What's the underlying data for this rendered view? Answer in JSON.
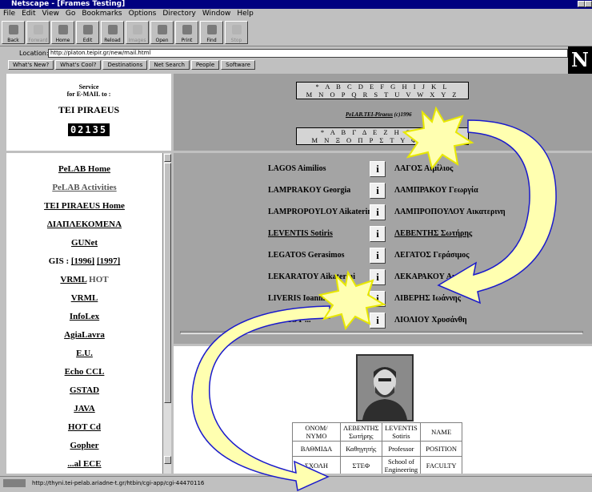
{
  "window": {
    "title": "Netscape - [Frames Testing]"
  },
  "menu": [
    "File",
    "Edit",
    "View",
    "Go",
    "Bookmarks",
    "Options",
    "Directory",
    "Window",
    "Help"
  ],
  "toolbar": [
    {
      "label": "Back",
      "icon": "back-arrow-icon",
      "enabled": true
    },
    {
      "label": "Forward",
      "icon": "forward-arrow-icon",
      "enabled": false
    },
    {
      "label": "Home",
      "icon": "home-icon",
      "enabled": true
    },
    {
      "label": "Edit",
      "icon": "edit-icon",
      "enabled": true
    },
    {
      "label": "Reload",
      "icon": "reload-icon",
      "enabled": true
    },
    {
      "label": "Images",
      "icon": "images-icon",
      "enabled": false
    },
    {
      "label": "Open",
      "icon": "open-icon",
      "enabled": true
    },
    {
      "label": "Print",
      "icon": "print-icon",
      "enabled": true
    },
    {
      "label": "Find",
      "icon": "find-icon",
      "enabled": true
    },
    {
      "label": "Stop",
      "icon": "stop-icon",
      "enabled": false
    }
  ],
  "location": {
    "label": "Location:",
    "url": "http://platon.teipir.gr/new/mail.html"
  },
  "directory_buttons": [
    "What's New?",
    "What's Cool?",
    "Destinations",
    "Net Search",
    "People",
    "Software"
  ],
  "brand_logo": "N",
  "service": {
    "line1": "Service",
    "line2": "for E-MAIL to :",
    "org": "TEI PIRAEUS",
    "counter": "02135"
  },
  "letters": {
    "latin_row1": "* A B C D E F G H I J K L",
    "latin_row2": "M N O P Q R S T U V W X Y Z",
    "credit": "PeLAB.TEI-Piraeus",
    "credit_year": "(c)1996",
    "greek_row1": "* Α Β Γ Δ Ε Ζ Η Θ Ι Κ Λ",
    "greek_row2": "Μ Ν Ξ Ο Π Ρ Σ Τ Υ Φ Χ Ψ Ω"
  },
  "nav": {
    "pelab_home": "PeLAB Home",
    "pelab_activities": "PeLAB Activities",
    "tei_home": "TEI PIRAEUS Home",
    "diapl": "ΔΙΑΠΛΕΚΟΜΕΝΑ",
    "gunet": "GUNet",
    "gis_prefix": "GIS :",
    "gis_1996": "[1996]",
    "gis_1997": "[1997]",
    "vrml_hot_a": "VRML",
    "vrml_hot_b": "HOT",
    "vrml": "VRML",
    "infolex": "InfoLex",
    "agialavra": "AgiaLavra",
    "eu": "E.U.",
    "echo": "Echo CCL",
    "gstad": "GSTAD",
    "java": "JAVA",
    "hotcd": "HOT Cd",
    "gopher": "Gopher",
    "last": "...al ECE"
  },
  "people": [
    {
      "latin": "LAGOS Aimilios",
      "greek": "ΛΑΓΟΣ Αιμίλιος",
      "link": false
    },
    {
      "latin": "LAMPRAKOY Georgia",
      "greek": "ΛΑΜΠΡΑΚΟΥ Γεωργία",
      "link": false
    },
    {
      "latin": "LAMPROPOYLOY Aikaterini",
      "greek": "ΛΑΜΠΡΟΠΟΥΛΟΥ Αικατερινη",
      "link": false
    },
    {
      "latin": "LEVENTIS Sotiris",
      "greek": "ΛΕΒΕΝΤΗΣ Σωτήρης",
      "link": true
    },
    {
      "latin": "LEGATOS Gerasimos",
      "greek": "ΛΕΓΑΤΟΣ Γεράσιμος",
      "link": false
    },
    {
      "latin": "LEKARATOY Aikaterini",
      "greek": "ΛΕΚΑΡΑΚΟΥ Αικατερινη",
      "link": false
    },
    {
      "latin": "LIVERIS Ioannis",
      "greek": "ΛΙΒΕΡΗΣ Ιωάννης",
      "link": false
    },
    {
      "latin": "LIOLIOY ...",
      "greek": "ΛΙΟΛΙΟΥ Χρυσάνθη",
      "link": false
    }
  ],
  "info_icon": "i",
  "info_table": {
    "rows": [
      [
        "ΟΝΟΜ/ΝΥΜΟ",
        "ΛΕΒΕΝΤΗΣ Σωτήρης",
        "LEVENTIS Sotiris",
        "NAME"
      ],
      [
        "ΒΑΘΜΙΔΑ",
        "Καθηγητής",
        "Professor",
        "POSITION"
      ],
      [
        "ΣΧΟΛΗ",
        "ΣΤΕΦ",
        "School of Engineering",
        "FACULTY"
      ]
    ]
  },
  "status": {
    "url": "http://thyni.tei-pelab.ariadne-t.gr/htbin/cgi-app/cgi-44470116"
  },
  "colors": {
    "title": "#000080",
    "frame_bg": "#a4a4a4",
    "arrow_fill": "#ffffb0",
    "arrow_stroke": "#1a1acc"
  }
}
